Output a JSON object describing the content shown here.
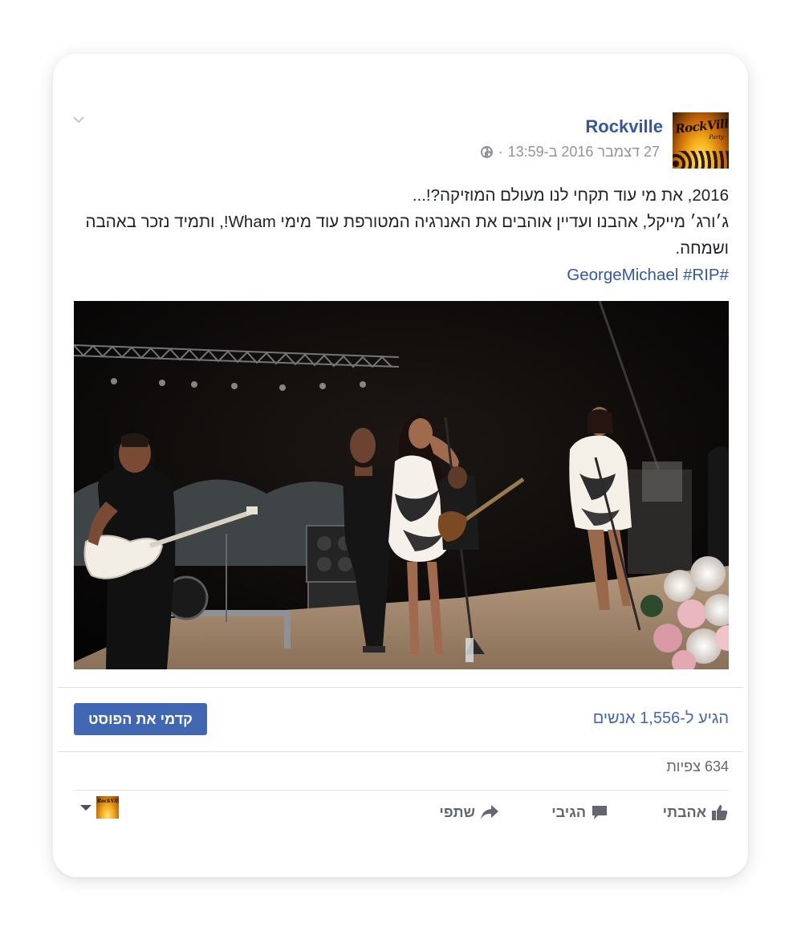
{
  "post": {
    "page_name": "Rockville",
    "avatar_logo": "RockVille",
    "avatar_sub": "Party",
    "timestamp": "27 דצמבר 2016 ב-13:59",
    "separator": "·",
    "privacy_icon": "globe-icon",
    "text_line1": "2016, את מי עוד תקחי לנו מעולם המוזיקה?!...",
    "text_line2": "ג׳ורג׳ מייקל, אהבנו ועדיין אוהבים את האנרגיה המטורפת עוד מימי Wham!, ותמיד נזכר באהבה ושמחה.",
    "hashtag1": "#GeorgeMichael",
    "hashtag2": "#RIP",
    "media_type": "video"
  },
  "boost": {
    "button_label": "קדמי את הפוסט",
    "reach_text": "הגיע ל-1,556 אנשים"
  },
  "stats": {
    "views_text": "634 צפיות"
  },
  "actions": {
    "like_label": "אהבתי",
    "comment_label": "הגיבי",
    "share_label": "שתפי"
  },
  "colors": {
    "link": "#365899",
    "button": "#4267b2",
    "muted": "#90949c"
  }
}
